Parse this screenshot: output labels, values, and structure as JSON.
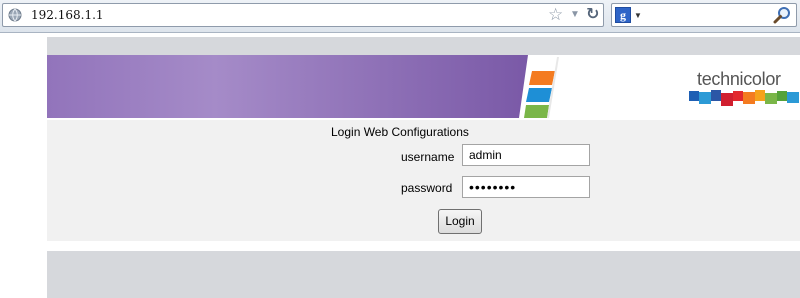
{
  "browser": {
    "url": "192.168.1.1",
    "icons": [
      "globe-icon",
      "bookmark-star-icon",
      "dropdown-arrow-icon",
      "reload-icon",
      "google-search-icon",
      "magnifier-icon"
    ],
    "search_engine_glyph": "g"
  },
  "banner": {
    "brand": "technicolor",
    "colors": {
      "purple": "#7b5aa6",
      "orange": "#f47b20",
      "blue": "#1e8fd6",
      "green": "#7ab648"
    }
  },
  "login": {
    "title": "Login Web Configurations",
    "username_label": "username",
    "username_value": "admin",
    "password_label": "password",
    "password_value": "••••••••",
    "button_label": "Login"
  }
}
